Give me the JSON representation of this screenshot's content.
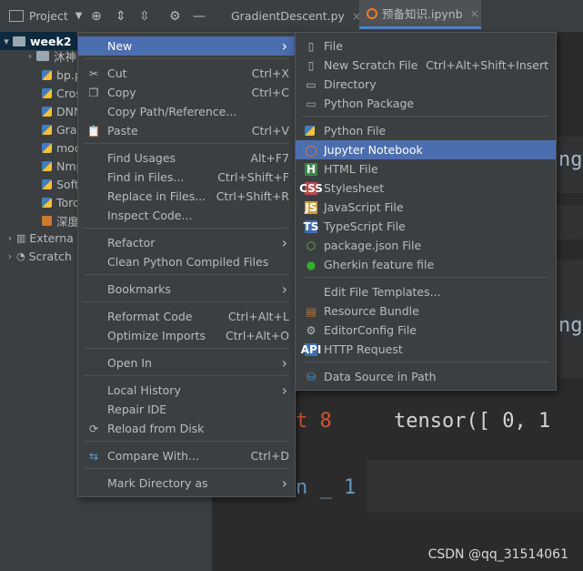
{
  "toolbar": {
    "project_label": "Project",
    "tabs": [
      {
        "label": "GradientDescent.py",
        "close": "×"
      },
      {
        "label": "预备知识.ipynb",
        "close": "×"
      }
    ]
  },
  "tree": {
    "root": "week2",
    "items": [
      "沐神",
      "bp.p",
      "Cros",
      "DNN",
      "Grad",
      "mod",
      "Nmp",
      "Soft",
      "Torc",
      "深度"
    ],
    "external": "Externa",
    "scratches": "Scratch"
  },
  "editor": {
    "frag_1": "nge",
    "frag_2": "nge",
    "line_prefix": "t 8",
    "tensor_text": "tensor([ 0,  1",
    "line2_prefix": "n _ 1"
  },
  "context_menu": [
    {
      "label": "New",
      "hasSub": true,
      "highlight": true
    },
    {
      "label": "Cut",
      "shortcut": "Ctrl+X",
      "icon": "scissors-icon"
    },
    {
      "label": "Copy",
      "shortcut": "Ctrl+C",
      "icon": "copy-icon"
    },
    {
      "label": "Copy Path/Reference..."
    },
    {
      "label": "Paste",
      "shortcut": "Ctrl+V",
      "icon": "paste-icon"
    },
    {
      "label": "Find Usages",
      "shortcut": "Alt+F7"
    },
    {
      "label": "Find in Files...",
      "shortcut": "Ctrl+Shift+F"
    },
    {
      "label": "Replace in Files...",
      "shortcut": "Ctrl+Shift+R"
    },
    {
      "label": "Inspect Code..."
    },
    {
      "label": "Refactor",
      "hasSub": true
    },
    {
      "label": "Clean Python Compiled Files"
    },
    {
      "label": "Bookmarks",
      "hasSub": true
    },
    {
      "label": "Reformat Code",
      "shortcut": "Ctrl+Alt+L"
    },
    {
      "label": "Optimize Imports",
      "shortcut": "Ctrl+Alt+O"
    },
    {
      "label": "Open In",
      "hasSub": true
    },
    {
      "label": "Local History",
      "hasSub": true
    },
    {
      "label": "Repair IDE"
    },
    {
      "label": "Reload from Disk",
      "icon": "reload-icon"
    },
    {
      "label": "Compare With...",
      "shortcut": "Ctrl+D",
      "icon": "compare-icon"
    },
    {
      "label": "Mark Directory as",
      "hasSub": true
    }
  ],
  "submenu": [
    {
      "label": "File",
      "icon": "file-icon"
    },
    {
      "label": "New Scratch File",
      "shortcut": "Ctrl+Alt+Shift+Insert",
      "icon": "scratch-file-icon"
    },
    {
      "label": "Directory",
      "icon": "folder-icon"
    },
    {
      "label": "Python Package",
      "icon": "package-icon"
    },
    {
      "label": "Python File",
      "icon": "python-icon"
    },
    {
      "label": "Jupyter Notebook",
      "icon": "jupyter-icon",
      "highlight": true
    },
    {
      "label": "HTML File",
      "icon": "html-icon",
      "badge": "H"
    },
    {
      "label": "Stylesheet",
      "icon": "css-icon",
      "badge": "CSS"
    },
    {
      "label": "JavaScript File",
      "icon": "js-icon",
      "badge": "JS"
    },
    {
      "label": "TypeScript File",
      "icon": "ts-icon",
      "badge": "TS"
    },
    {
      "label": "package.json File",
      "icon": "npm-icon"
    },
    {
      "label": "Gherkin feature file",
      "icon": "gherkin-icon"
    },
    {
      "label": "Edit File Templates..."
    },
    {
      "label": "Resource Bundle",
      "icon": "resource-bundle-icon"
    },
    {
      "label": "EditorConfig File",
      "icon": "gear-icon"
    },
    {
      "label": "HTTP Request",
      "icon": "api-icon",
      "badge": "API"
    },
    {
      "label": "Data Source in Path",
      "icon": "database-icon"
    }
  ],
  "watermark": "CSDN @qq_31514061",
  "colors": {
    "highlight": "#4b6eaf",
    "menu_bg": "#3c3f41",
    "editor_bg": "#2b2b2b"
  }
}
